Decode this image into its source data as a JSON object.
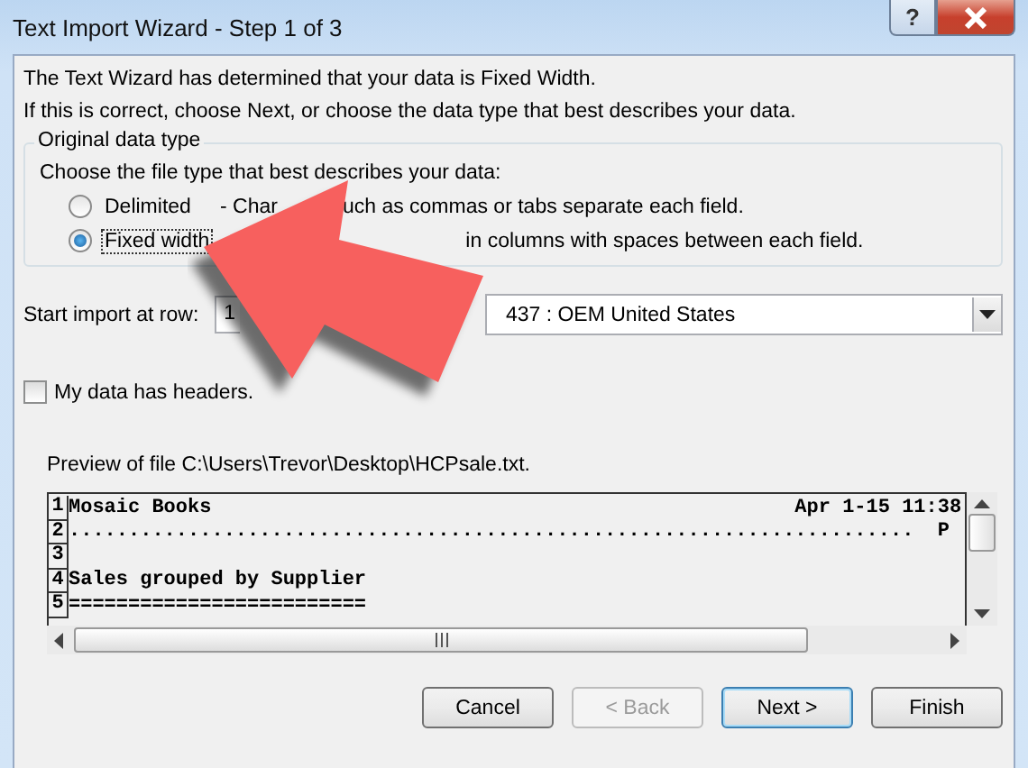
{
  "window": {
    "title": "Text Import Wizard - Step 1 of 3",
    "help_label": "?"
  },
  "intro": [
    "The Text Wizard has determined that your data is Fixed Width.",
    "If this is correct, choose Next, or choose the data type that best describes your data."
  ],
  "original_data_type": {
    "title": "Original data type",
    "prompt": "Choose the file type that best describes your data:",
    "options": [
      {
        "label": "Delimited",
        "selected": false,
        "description_parts": [
          "- Char",
          "uch as commas or tabs separate each field."
        ]
      },
      {
        "label": "Fixed width",
        "selected": true,
        "description_parts": [
          "in columns with spaces between each field."
        ]
      }
    ]
  },
  "start_import": {
    "label": "Start import at row:",
    "value": "1"
  },
  "file_origin": {
    "value": "437 : OEM United States"
  },
  "headers_checkbox": {
    "label": "My data has headers.",
    "checked": false
  },
  "preview": {
    "caption": "Preview of file C:\\Users\\Trevor\\Desktop\\HCPsale.txt.",
    "lines": [
      {
        "number": "1",
        "text": "Mosaic Books                                                 Apr 1-15 11:38"
      },
      {
        "number": "2",
        "text": ".......................................................................  P"
      },
      {
        "number": "3"
      },
      {
        "number": "4",
        "text": "Sales grouped by Supplier"
      },
      {
        "number": "5",
        "text": "========================="
      }
    ]
  },
  "buttons": [
    {
      "label": "Cancel",
      "disabled": false,
      "selected": false
    },
    {
      "label": "< Back",
      "disabled": true,
      "selected": false
    },
    {
      "label": "Next >",
      "disabled": false,
      "selected": true
    },
    {
      "label": "Finish",
      "disabled": false,
      "selected": false
    }
  ]
}
